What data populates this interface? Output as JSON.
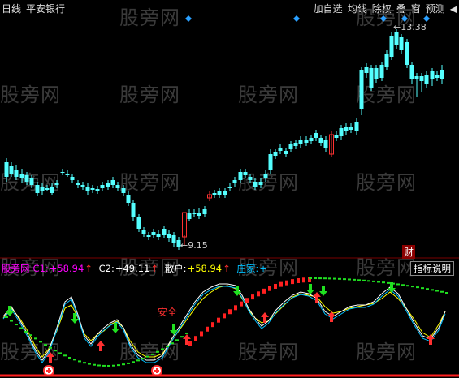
{
  "header": {
    "period": "日线",
    "stock_name": "平安银行",
    "menu": [
      "加自选",
      "均线",
      "除权",
      "叠",
      "窗",
      "预测"
    ]
  },
  "watermark": "股旁网",
  "price_chart": {
    "high_label": "13.38",
    "low_label": "9.15",
    "badge": "财"
  },
  "indicator": {
    "name": "股旁网",
    "c1_label": "C1:",
    "c1_value": "+58.94",
    "c2_label": "C2:",
    "c2_value": "+49.11",
    "sanhu_label": "散户:",
    "sanhu_value": "+58.94",
    "zhuangjia_label": "庄家:",
    "zhuangjia_value": "+",
    "explain_button": "指标说明",
    "safe_label": "安全"
  },
  "colors": {
    "up": "#ff3232",
    "down": "#54ffff",
    "purple": "#ff00ff",
    "yellow": "#ffff00",
    "cyan": "#00c0ff",
    "green": "#00ff00"
  }
}
